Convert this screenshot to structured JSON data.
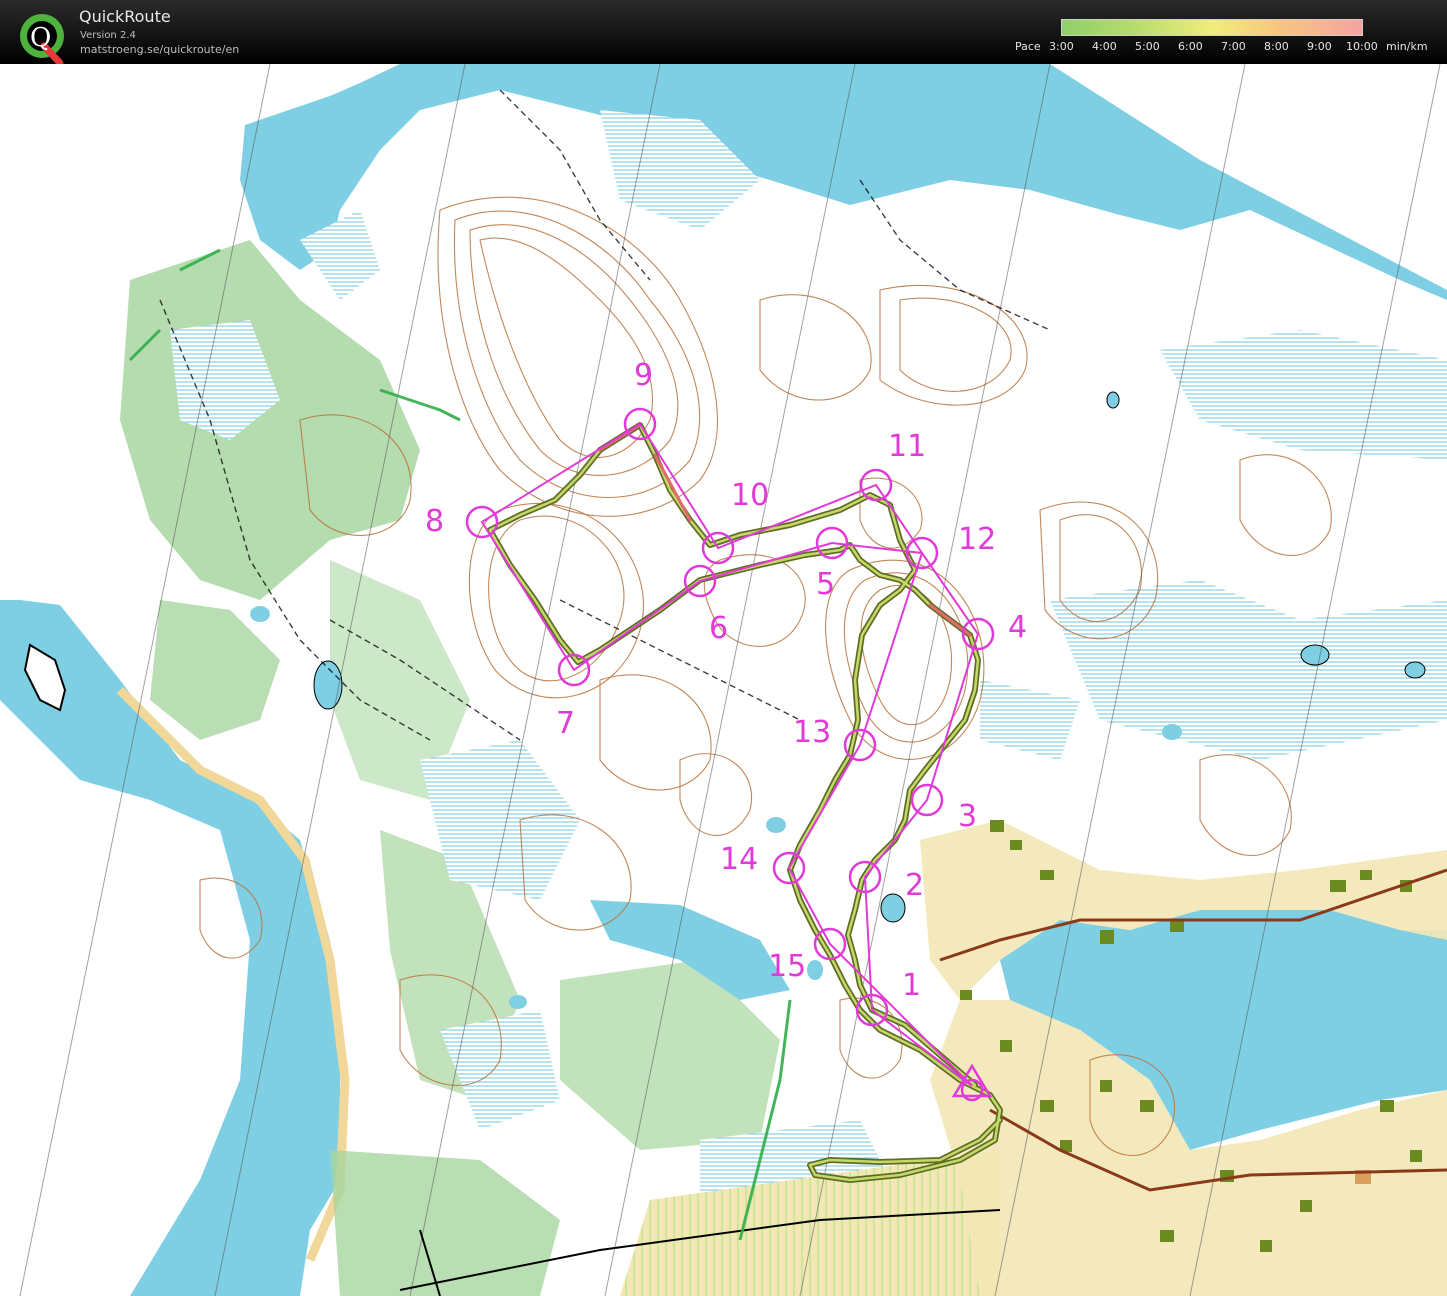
{
  "app": {
    "name": "QuickRoute",
    "version": "Version 2.4",
    "url": "matstroeng.se/quickroute/en"
  },
  "pace_legend": {
    "label": "Pace",
    "ticks": [
      "3:00",
      "4:00",
      "5:00",
      "6:00",
      "7:00",
      "8:00",
      "9:00",
      "10:00"
    ],
    "unit": "min/km",
    "colors": [
      "#8fcf6b",
      "#b9dc6e",
      "#f0ee79",
      "#f6c681",
      "#f4a3a3"
    ]
  },
  "map": {
    "controls": [
      {
        "label": "1"
      },
      {
        "label": "2"
      },
      {
        "label": "3"
      },
      {
        "label": "4"
      },
      {
        "label": "5"
      },
      {
        "label": "6"
      },
      {
        "label": "7"
      },
      {
        "label": "8"
      },
      {
        "label": "9"
      },
      {
        "label": "10"
      },
      {
        "label": "11"
      },
      {
        "label": "12"
      },
      {
        "label": "13"
      },
      {
        "label": "14"
      },
      {
        "label": "15"
      }
    ],
    "colors": {
      "water": "#7ecfe3",
      "open_land": "#f4e6b6",
      "green": "#a8d6a0",
      "contour": "#b8733c",
      "course": "#e23ad8",
      "route": "#6f7d2a"
    }
  }
}
